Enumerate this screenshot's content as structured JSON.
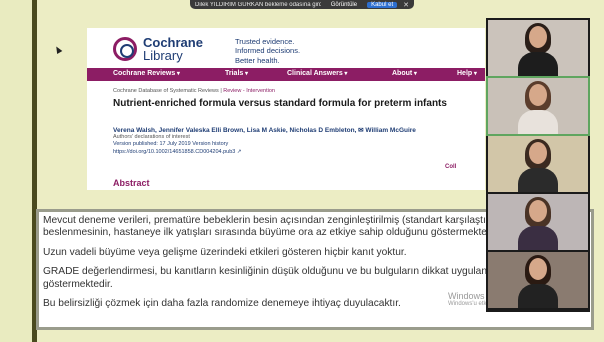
{
  "notification": {
    "message": "Dilek YILDIRIM GÜRKAN bekleme odasına girdi",
    "view_label": "Görüntüle",
    "accept_label": "Kabul et",
    "close_label": "✕"
  },
  "slide": {
    "logo_line1": "Cochrane",
    "logo_line2": "Library",
    "tagline": [
      "Trusted evidence.",
      "Informed decisions.",
      "Better health."
    ],
    "nav": [
      "Cochrane Reviews",
      "Trials",
      "Clinical Answers",
      "About",
      "Help"
    ],
    "breadcrumb_source": "Cochrane Database of Systematic Reviews",
    "breadcrumb_tag": "Review - Intervention",
    "title": "Nutrient-enriched formula versus standard formula for preterm infants",
    "authors": "Verena Walsh, Jennifer Valeska Elli Brown, Lisa M Askie, Nicholas D Embleton,  ✉ William McGuire",
    "declarations": "Authors' declarations of interest",
    "version_line": "Version published: 17 July 2019   Version history",
    "doi": "https://doi.org/10.1002/14651858.CD004204.pub3 ↗",
    "collapse": "Coll",
    "abstract_heading": "Abstract"
  },
  "summary_text": [
    "Mevcut deneme verileri, prematüre bebeklerin besin açısından zenginleştirilmiş (standart karşılaştırıldığında) mamalarla beslenmesinin, hastaneye ilk yatışları sırasında büyüme ora az etkiye sahip olduğunu göstermektedir.",
    "Uzun vadeli büyüme veya gelişme üzerindeki etkileri gösteren hiçbir kanıt yoktur.",
    "GRADE değerlendirmesi, bu kanıtların kesinliğinin düşük olduğunu ve bu bulguların dikkat uygulanması gerektiğini göstermektedir.",
    "Bu belirsizliği çözmek için daha fazla randomize denemeye ihtiyaç duyulacaktır."
  ],
  "watermark": {
    "line1": "Windows",
    "line2": "Windows'u etkinleştirmek için Ayarlar'a gidi"
  },
  "participants": [
    {
      "hair": "#2a1e18",
      "top": "#1d1d1d",
      "bg": "#cbc3bb"
    },
    {
      "hair": "#5b3d2c",
      "top": "#e8e2dc",
      "bg": "#c9c1b8"
    },
    {
      "hair": "#3b2a20",
      "top": "#2b2b2b",
      "bg": "#d2c6a8"
    },
    {
      "hair": "#4a3326",
      "top": "#3a2e42",
      "bg": "#bdb6b6"
    },
    {
      "hair": "#2a1a12",
      "top": "#222222",
      "bg": "#8a7b70"
    }
  ]
}
